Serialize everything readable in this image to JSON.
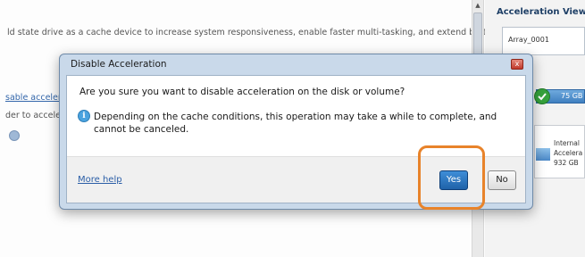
{
  "background": {
    "description": "ld state drive as a cache device to increase system responsiveness, enable faster multi-tasking, and extend battery",
    "link_partial": "sable acceler",
    "text_partial": "der to acceler"
  },
  "right_panel": {
    "title": "Acceleration View",
    "array_name": "Array_0001",
    "bar_label": "75 GB",
    "card_line1": "Internal",
    "card_line2": "Accelera",
    "card_line3": "932 GB"
  },
  "dialog": {
    "title": "Disable Acceleration",
    "close_glyph": "x",
    "question": "Are you sure you want to disable acceleration on the disk or volume?",
    "info_glyph": "i",
    "info_text": "Depending on the cache conditions, this operation may take a while to complete, and cannot be canceled.",
    "more_help": "More help",
    "yes_label": "Yes",
    "no_label": "No"
  },
  "colors": {
    "highlight": "#e8832a",
    "primary_button": "#1f62a8",
    "dialog_frame": "#c9d9ea"
  },
  "icons": [
    "info-icon",
    "close-icon",
    "help-icon",
    "check-icon",
    "drive-icon"
  ]
}
